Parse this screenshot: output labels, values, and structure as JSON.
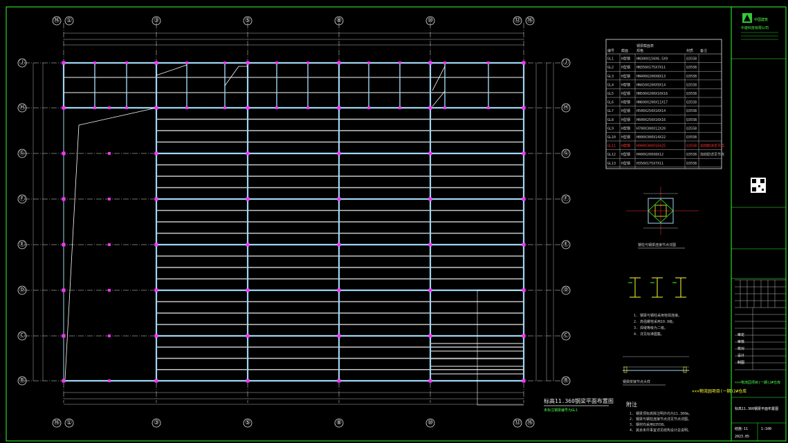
{
  "drawing": {
    "axes_vertical": [
      "⑯",
      "①",
      "③",
      "⑤",
      "⑧",
      "⑩",
      "⑫",
      "⑯"
    ],
    "axes_horizontal": [
      "Ⓙ",
      "Ⓗ",
      "Ⓖ",
      "Ⓕ",
      "Ⓔ",
      "Ⓓ",
      "Ⓒ",
      "Ⓑ"
    ],
    "plan_title": "标高11.360钢梁平面布置图",
    "plan_subtitle": "未标注钢梁编号为GL1",
    "section_title": "钢梁截面表",
    "section_table_header": [
      "编号",
      "截面",
      "规格",
      "材质",
      "备注"
    ],
    "section_rows": [
      [
        "GL1",
        "H型钢",
        "HN300X150X6.5X9",
        "Q355B",
        ""
      ],
      [
        "GL2",
        "H型钢",
        "HN350X175X7X11",
        "Q355B",
        ""
      ],
      [
        "GL3",
        "H型钢",
        "HN400X200X8X13",
        "Q355B",
        ""
      ],
      [
        "GL4",
        "H型钢",
        "HN450X200X9X14",
        "Q355B",
        ""
      ],
      [
        "GL5",
        "H型钢",
        "HN500X200X10X16",
        "Q355B",
        ""
      ],
      [
        "GL6",
        "H型钢",
        "HN600X200X11X17",
        "Q355B",
        ""
      ],
      [
        "GL7",
        "H型钢",
        "H500X250X10X14",
        "Q355B",
        ""
      ],
      [
        "GL8",
        "H型钢",
        "H600X250X10X16",
        "Q355B",
        ""
      ],
      [
        "GL9",
        "H型钢",
        "H700X300X12X20",
        "Q355B",
        ""
      ],
      [
        "GL10",
        "H型钢",
        "H800X300X14X22",
        "Q355B",
        ""
      ],
      [
        "GL11",
        "H型钢",
        "H900X300X16X25",
        "Q355B",
        "加劲肋详见节点"
      ],
      [
        "GL12",
        "H型钢",
        "H400X200X8X12",
        "Q355B",
        "加劲肋详见节点"
      ],
      [
        "GL13",
        "H型钢",
        "H350X175X7X11",
        "Q355B",
        ""
      ]
    ],
    "detail1_title": "钢柱与钢梁连接节点详图",
    "detail2_title": "钢梁拼接节点大样",
    "notes_heading": "附注",
    "notes": [
      "1. 钢梁顶标高除注明外均为11.360m。",
      "2. 钢梁与钢柱连接节点详见节点详图。",
      "3. 钢材均采用Q355B。",
      "4. 其余未尽事宜详见结构设计总说明。"
    ],
    "detail_notes": [
      "1. 钢梁与钢柱采用栓焊连接。",
      "2. 高强螺栓采用10.9级。",
      "3. 焊缝等级为二级。",
      "4. 详见标准图集。"
    ]
  },
  "title_block": {
    "company": "中国建筑",
    "company_sub": "中建科技有限公司",
    "project": "×××物流园项目(一期)2#仓库",
    "drawing_name": "标高11.360钢梁平面布置图",
    "drawing_no": "结施-11",
    "scale": "1:100",
    "rows": [
      "审定",
      "审核",
      "校对",
      "设计",
      "制图"
    ],
    "date": "2023.05"
  },
  "colors": {
    "beam_main": "#9fd7f2",
    "beam_secondary": "#c8c8c8",
    "grid": "#e6e6e6",
    "column": "#ff33ff",
    "frame": "#33ff33",
    "highlight": "#ff3333"
  }
}
